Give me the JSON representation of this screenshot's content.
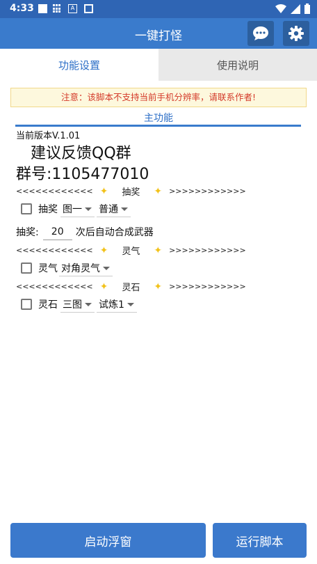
{
  "status_bar": {
    "time": "4:33"
  },
  "app_bar": {
    "title": "一键打怪"
  },
  "tabs": [
    {
      "label": "功能设置"
    },
    {
      "label": "使用说明"
    }
  ],
  "notice": "注意：该脚本不支持当前手机分辨率，请联系作者!",
  "section": {
    "title": "主功能"
  },
  "version": "当前版本V.1.01",
  "feedback": "建议反馈QQ群",
  "group_number": "群号:1105477010",
  "dividers": {
    "left": "<<<<<<<<<<<<",
    "right": ">>>>>>>>>>>>",
    "lottery": "抽奖",
    "aura": "灵气",
    "spirit_stone": "灵石"
  },
  "lottery_row": {
    "label": "抽奖",
    "map": "图一",
    "mode": "普通"
  },
  "lottery_count": {
    "prefix": "抽奖:",
    "value": "20",
    "suffix": "次后自动合成武器"
  },
  "aura_row": {
    "label": "灵气",
    "option": "对角灵气"
  },
  "stone_row": {
    "label": "灵石",
    "map": "三图",
    "mode": "试炼1"
  },
  "buttons": {
    "float": "启动浮窗",
    "run": "运行脚本"
  },
  "colors": {
    "primary": "#3a7bcc",
    "notice_text": "#d43a2a",
    "sparkle": "#f2c21b"
  }
}
